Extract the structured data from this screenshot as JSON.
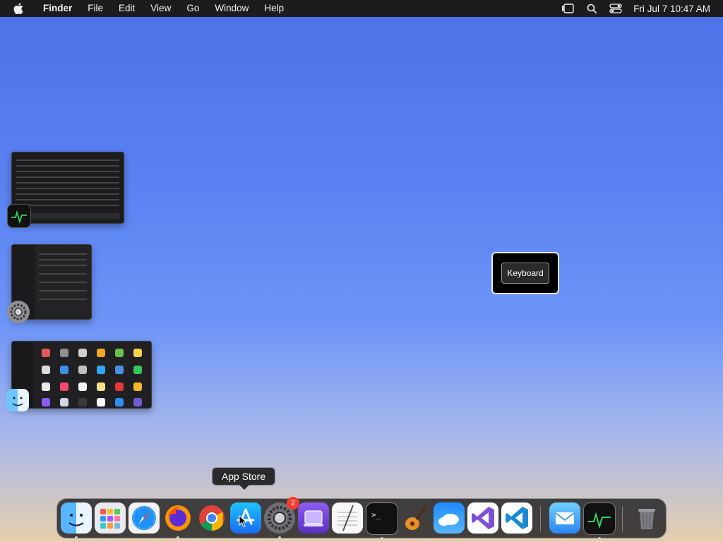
{
  "menubar": {
    "app_name": "Finder",
    "menus": [
      "File",
      "Edit",
      "View",
      "Go",
      "Window",
      "Help"
    ],
    "clock": "Fri Jul 7  10:47 AM"
  },
  "stage_manager": {
    "groups": [
      {
        "app": "Activity Monitor",
        "icon": "activity-monitor-icon"
      },
      {
        "app": "System Settings",
        "icon": "system-settings-icon"
      },
      {
        "app": "Finder",
        "icon": "finder-icon"
      }
    ]
  },
  "keyboard_osd": {
    "label": "Keyboard"
  },
  "tooltip": {
    "label": "App Store"
  },
  "dock": {
    "apps": [
      {
        "name": "Finder",
        "icon": "finder-icon",
        "running": true
      },
      {
        "name": "Launchpad",
        "icon": "launchpad-icon",
        "running": false
      },
      {
        "name": "Safari",
        "icon": "safari-icon",
        "running": false
      },
      {
        "name": "Firefox",
        "icon": "firefox-icon",
        "running": true
      },
      {
        "name": "Chrome",
        "icon": "chrome-icon",
        "running": false
      },
      {
        "name": "App Store",
        "icon": "app-store-icon",
        "running": false
      },
      {
        "name": "System Settings",
        "icon": "system-settings-icon",
        "running": true,
        "badge": "2"
      },
      {
        "name": "Simulator",
        "icon": "simulator-icon",
        "running": false
      },
      {
        "name": "TextEdit",
        "icon": "textedit-icon",
        "running": false
      },
      {
        "name": "Terminal",
        "icon": "terminal-icon",
        "running": true
      },
      {
        "name": "GarageBand",
        "icon": "garageband-icon",
        "running": false
      },
      {
        "name": "Weather",
        "icon": "weather-icon",
        "running": false
      },
      {
        "name": "Visual Studio",
        "icon": "visual-studio-icon",
        "running": false
      },
      {
        "name": "VS Code",
        "icon": "vscode-icon",
        "running": false
      },
      {
        "name": "Mail",
        "icon": "mail-icon",
        "running": false
      },
      {
        "name": "Activity Monitor",
        "icon": "activity-monitor-icon",
        "running": true
      },
      {
        "name": "Trash",
        "icon": "trash-icon",
        "running": false
      }
    ],
    "badge_count": "2"
  }
}
